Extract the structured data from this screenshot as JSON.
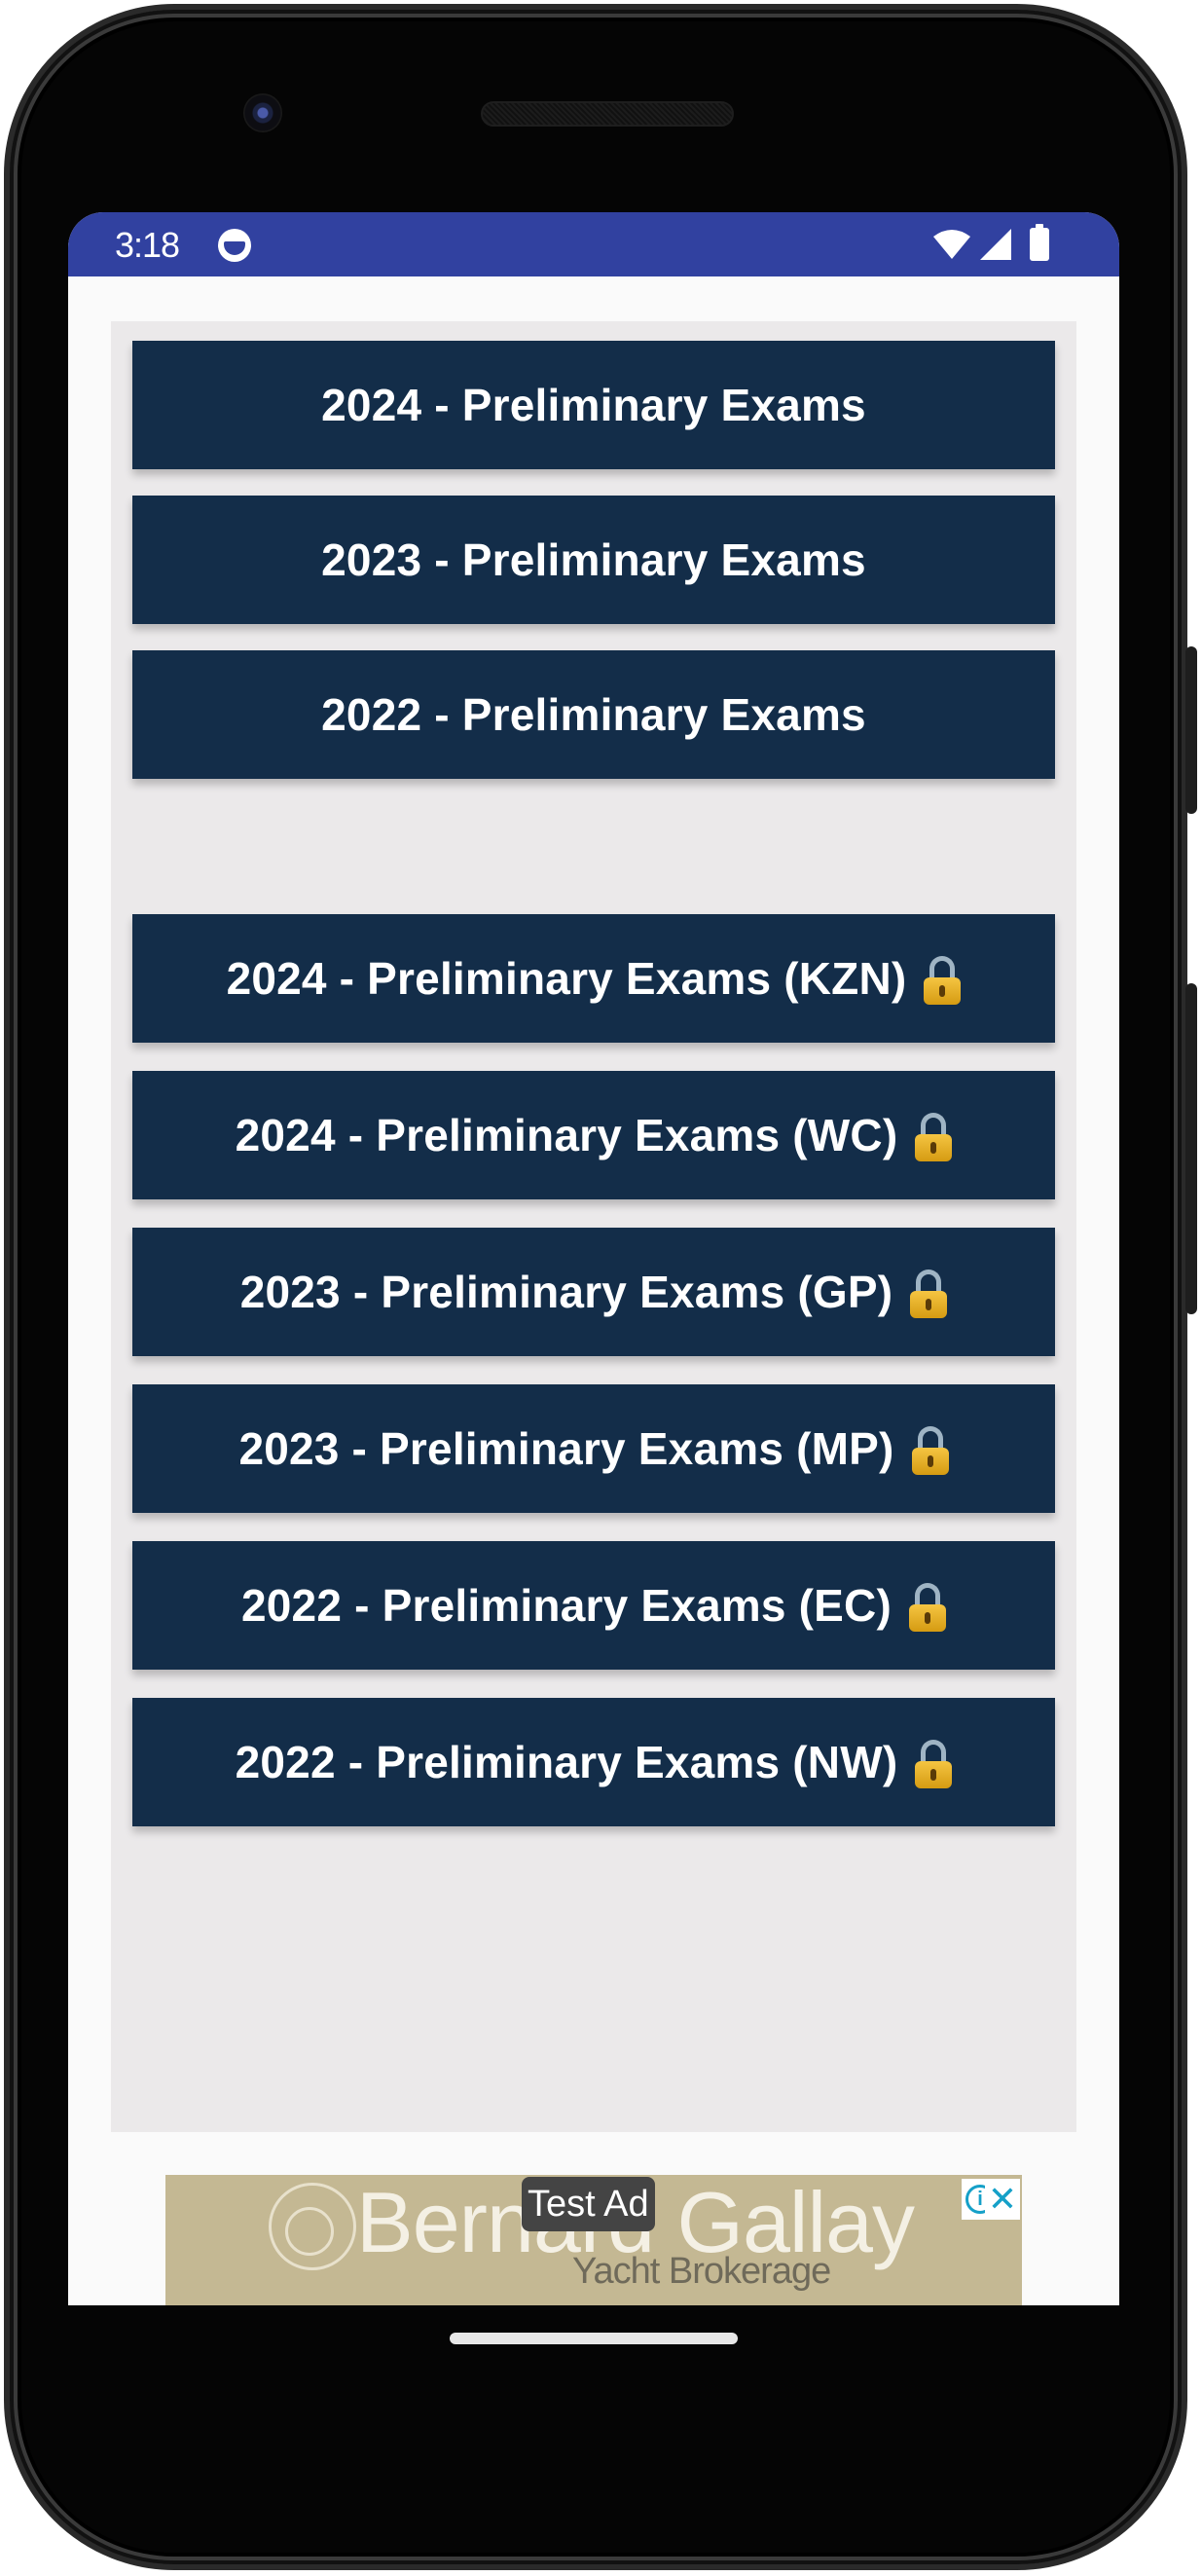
{
  "status_bar": {
    "time": "3:18",
    "app_icon": "notification-app-icon",
    "icons": [
      "wifi-icon",
      "cellular-signal-icon",
      "battery-icon"
    ],
    "background_color": "#3141a0"
  },
  "exam_lists": {
    "free": [
      {
        "label": "2024 - Preliminary Exams",
        "locked": false
      },
      {
        "label": "2023 - Preliminary Exams",
        "locked": false
      },
      {
        "label": "2022 - Preliminary Exams",
        "locked": false
      }
    ],
    "locked": [
      {
        "label": "2024 - Preliminary Exams (KZN)",
        "locked": true,
        "icon": "lock-icon"
      },
      {
        "label": "2024 - Preliminary Exams (WC)",
        "locked": true,
        "icon": "lock-icon"
      },
      {
        "label": "2023 - Preliminary Exams (GP)",
        "locked": true,
        "icon": "lock-icon"
      },
      {
        "label": "2023 - Preliminary Exams (MP)",
        "locked": true,
        "icon": "lock-icon"
      },
      {
        "label": "2022 - Preliminary Exams (EC)",
        "locked": true,
        "icon": "lock-icon"
      },
      {
        "label": "2022 - Preliminary Exams (NW)",
        "locked": true,
        "icon": "lock-icon"
      }
    ],
    "button_color": "#132d49",
    "panel_color": "#ebe9ea"
  },
  "ad": {
    "test_label": "Test Ad",
    "brand": "Bernard Gallay",
    "tagline": "Yacht Brokerage",
    "info_icon": "i",
    "close_icon": "✕",
    "background_color": "#c4b893",
    "accent_color": "#15a0c8"
  }
}
